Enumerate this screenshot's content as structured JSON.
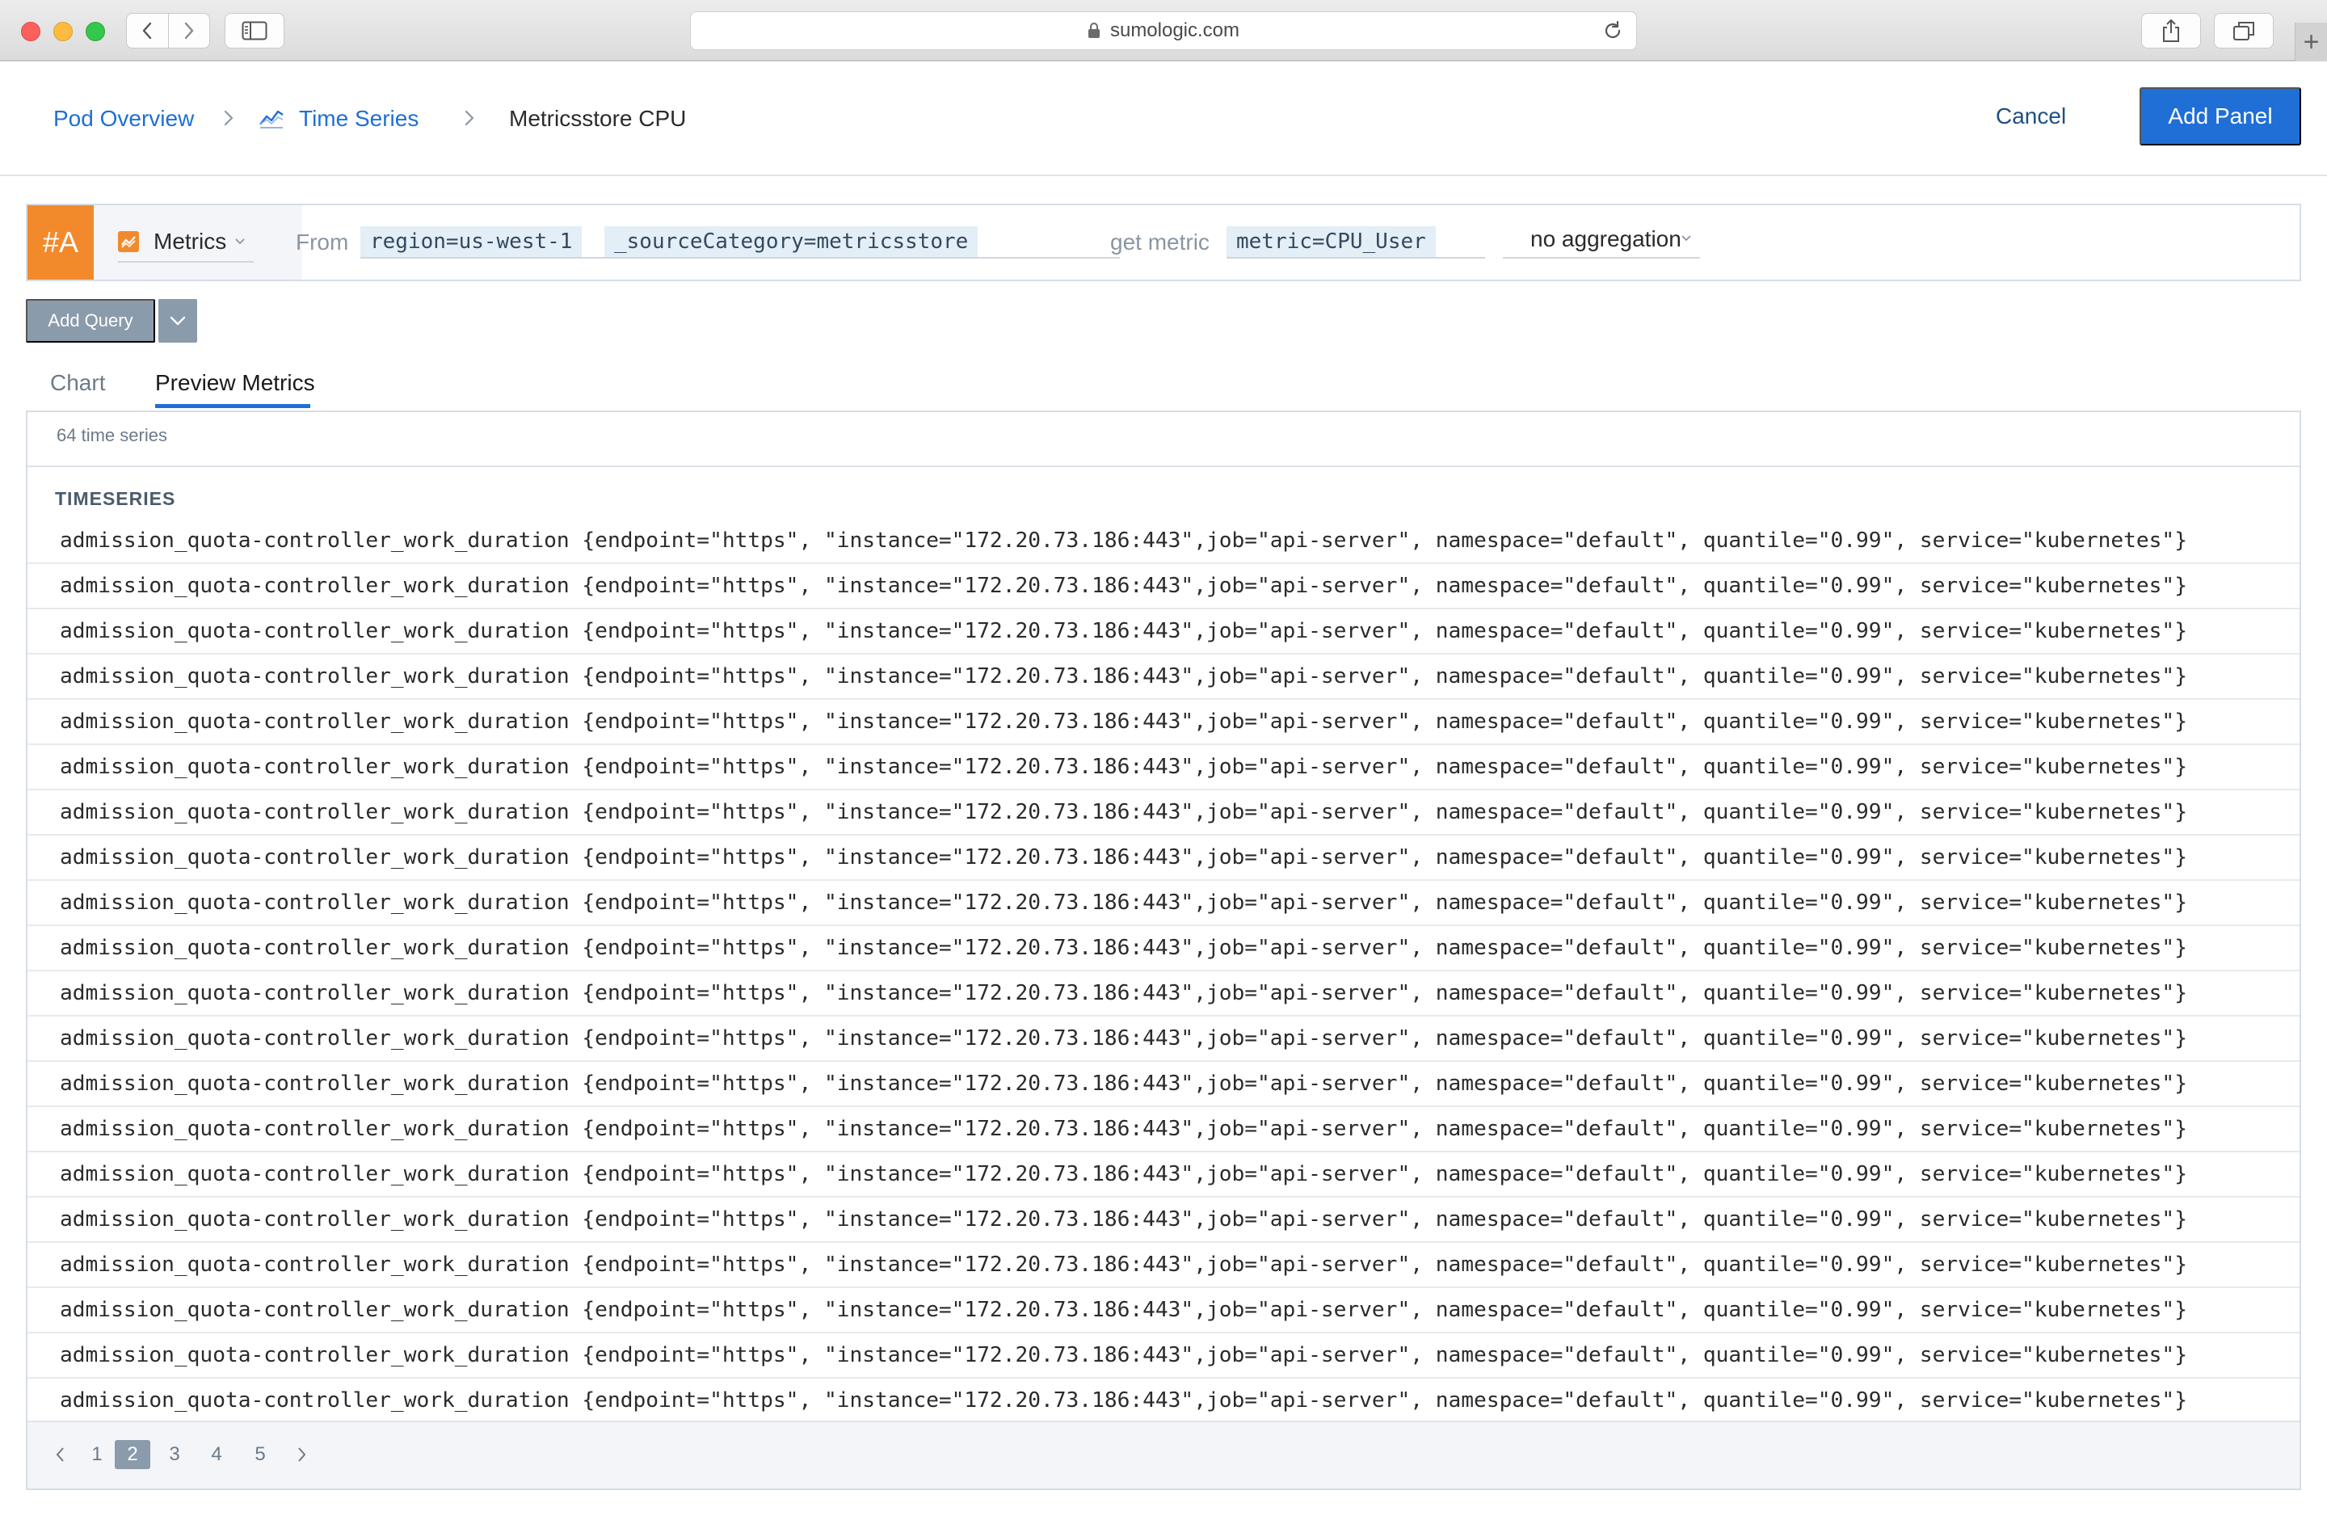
{
  "browser": {
    "url": "sumologic.com"
  },
  "breadcrumb": {
    "items": [
      "Pod Overview",
      "Time Series",
      "Metricsstore CPU"
    ]
  },
  "header": {
    "cancel_label": "Cancel",
    "add_panel_label": "Add Panel"
  },
  "query": {
    "tag": "#A",
    "type": "Metrics",
    "from_label": "From",
    "from_filters": [
      "region=us-west-1",
      "_sourceCategory=metricsstore"
    ],
    "get_metric_label": "get metric",
    "metric_filter": "metric=CPU_User",
    "aggregation": "no aggregation"
  },
  "add_query_label": "Add Query",
  "tabs": [
    "Chart",
    "Preview Metrics"
  ],
  "active_tab": "Preview Metrics",
  "results": {
    "count_text": "64 time series",
    "heading": "TIMESERIES",
    "rows": [
      "admission_quota-controller_work_duration {endpoint=\"https\", \"instance=\"172.20.73.186:443\",job=\"api-server\", namespace=\"default\", quantile=\"0.99\", service=\"kubernetes\"}",
      "admission_quota-controller_work_duration {endpoint=\"https\", \"instance=\"172.20.73.186:443\",job=\"api-server\", namespace=\"default\", quantile=\"0.99\", service=\"kubernetes\"}",
      "admission_quota-controller_work_duration {endpoint=\"https\", \"instance=\"172.20.73.186:443\",job=\"api-server\", namespace=\"default\", quantile=\"0.99\", service=\"kubernetes\"}",
      "admission_quota-controller_work_duration {endpoint=\"https\", \"instance=\"172.20.73.186:443\",job=\"api-server\", namespace=\"default\", quantile=\"0.99\", service=\"kubernetes\"}",
      "admission_quota-controller_work_duration {endpoint=\"https\", \"instance=\"172.20.73.186:443\",job=\"api-server\", namespace=\"default\", quantile=\"0.99\", service=\"kubernetes\"}",
      "admission_quota-controller_work_duration {endpoint=\"https\", \"instance=\"172.20.73.186:443\",job=\"api-server\", namespace=\"default\", quantile=\"0.99\", service=\"kubernetes\"}",
      "admission_quota-controller_work_duration {endpoint=\"https\", \"instance=\"172.20.73.186:443\",job=\"api-server\", namespace=\"default\", quantile=\"0.99\", service=\"kubernetes\"}",
      "admission_quota-controller_work_duration {endpoint=\"https\", \"instance=\"172.20.73.186:443\",job=\"api-server\", namespace=\"default\", quantile=\"0.99\", service=\"kubernetes\"}",
      "admission_quota-controller_work_duration {endpoint=\"https\", \"instance=\"172.20.73.186:443\",job=\"api-server\", namespace=\"default\", quantile=\"0.99\", service=\"kubernetes\"}",
      "admission_quota-controller_work_duration {endpoint=\"https\", \"instance=\"172.20.73.186:443\",job=\"api-server\", namespace=\"default\", quantile=\"0.99\", service=\"kubernetes\"}",
      "admission_quota-controller_work_duration {endpoint=\"https\", \"instance=\"172.20.73.186:443\",job=\"api-server\", namespace=\"default\", quantile=\"0.99\", service=\"kubernetes\"}",
      "admission_quota-controller_work_duration {endpoint=\"https\", \"instance=\"172.20.73.186:443\",job=\"api-server\", namespace=\"default\", quantile=\"0.99\", service=\"kubernetes\"}",
      "admission_quota-controller_work_duration {endpoint=\"https\", \"instance=\"172.20.73.186:443\",job=\"api-server\", namespace=\"default\", quantile=\"0.99\", service=\"kubernetes\"}",
      "admission_quota-controller_work_duration {endpoint=\"https\", \"instance=\"172.20.73.186:443\",job=\"api-server\", namespace=\"default\", quantile=\"0.99\", service=\"kubernetes\"}",
      "admission_quota-controller_work_duration {endpoint=\"https\", \"instance=\"172.20.73.186:443\",job=\"api-server\", namespace=\"default\", quantile=\"0.99\", service=\"kubernetes\"}",
      "admission_quota-controller_work_duration {endpoint=\"https\", \"instance=\"172.20.73.186:443\",job=\"api-server\", namespace=\"default\", quantile=\"0.99\", service=\"kubernetes\"}",
      "admission_quota-controller_work_duration {endpoint=\"https\", \"instance=\"172.20.73.186:443\",job=\"api-server\", namespace=\"default\", quantile=\"0.99\", service=\"kubernetes\"}",
      "admission_quota-controller_work_duration {endpoint=\"https\", \"instance=\"172.20.73.186:443\",job=\"api-server\", namespace=\"default\", quantile=\"0.99\", service=\"kubernetes\"}",
      "admission_quota-controller_work_duration {endpoint=\"https\", \"instance=\"172.20.73.186:443\",job=\"api-server\", namespace=\"default\", quantile=\"0.99\", service=\"kubernetes\"}",
      "admission_quota-controller_work_duration {endpoint=\"https\", \"instance=\"172.20.73.186:443\",job=\"api-server\", namespace=\"default\", quantile=\"0.99\", service=\"kubernetes\"}"
    ]
  },
  "pagination": {
    "pages": [
      "1",
      "2",
      "3",
      "4",
      "5"
    ],
    "current": "2"
  },
  "colors": {
    "accent": "#1f6fd6",
    "query_tag": "#f28a2c",
    "chip_bg": "#e3eef7"
  }
}
